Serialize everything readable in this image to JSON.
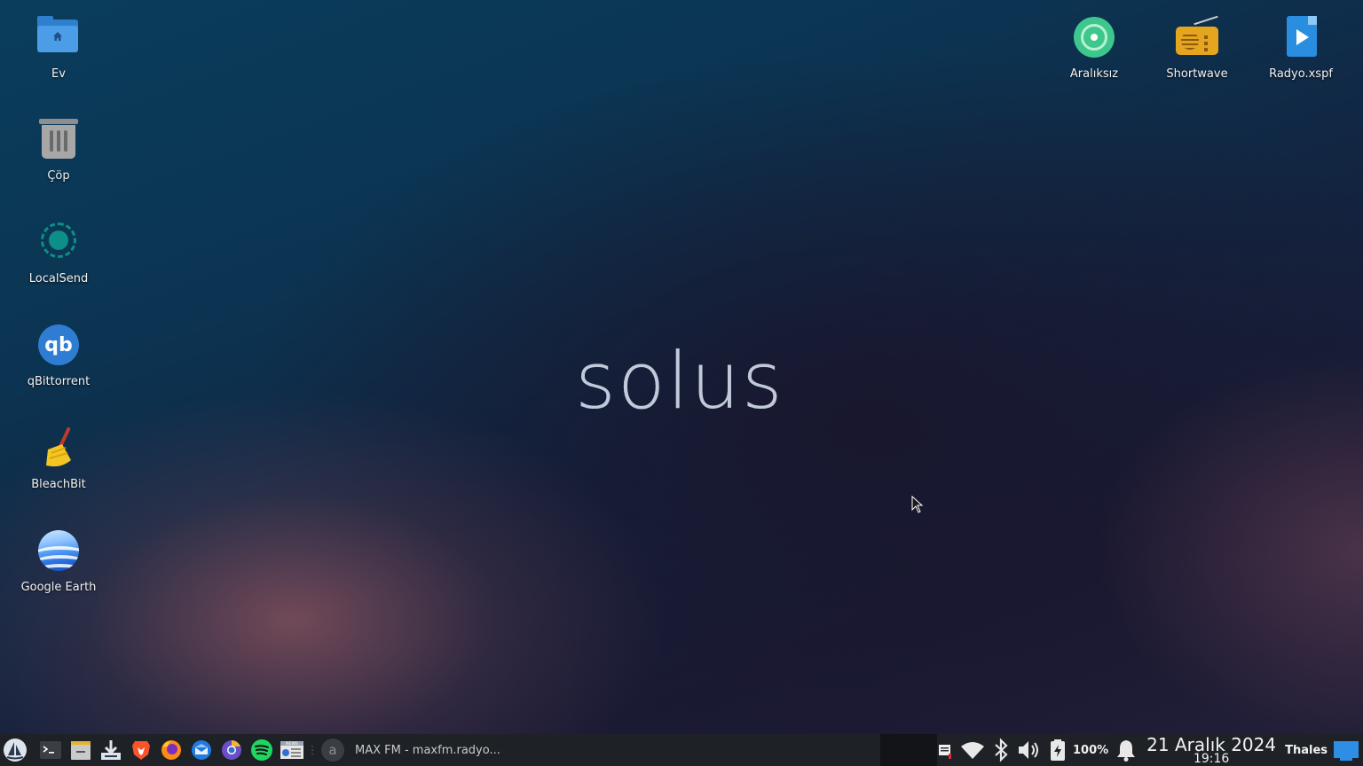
{
  "desktop": {
    "left_icons": [
      {
        "label": "Ev",
        "icon": "home-folder-icon"
      },
      {
        "label": "Çöp",
        "icon": "trash-icon"
      },
      {
        "label": "LocalSend",
        "icon": "localsend-icon"
      },
      {
        "label": "qBittorrent",
        "icon": "qbittorrent-icon"
      },
      {
        "label": "BleachBit",
        "icon": "bleachbit-broom-icon"
      },
      {
        "label": "Google Earth",
        "icon": "google-earth-icon"
      }
    ],
    "right_icons": [
      {
        "label": "Aralıksız",
        "icon": "araliksiz-icon"
      },
      {
        "label": "Shortwave",
        "icon": "shortwave-radio-icon"
      },
      {
        "label": "Radyo.xspf",
        "icon": "playlist-file-icon"
      }
    ],
    "wallpaper_logo": "solus"
  },
  "taskbar": {
    "launchers": [
      "solus-menu-icon",
      "terminal-icon",
      "files-icon",
      "downloads-icon",
      "brave-icon",
      "firefox-icon",
      "thunderbird-icon",
      "chromium-icon",
      "spotify-icon",
      "news-icon"
    ],
    "news_badge": "NEWS",
    "window_title": "MAX FM - maxfm.radyo...",
    "window_app_letter": "a",
    "battery_percent": "100%",
    "date": "21 Aralık 2024",
    "time": "19:16",
    "user": "Thales"
  },
  "colors": {
    "taskbar_bg": "#1e2125",
    "accent_blue": "#2f7fcf"
  }
}
